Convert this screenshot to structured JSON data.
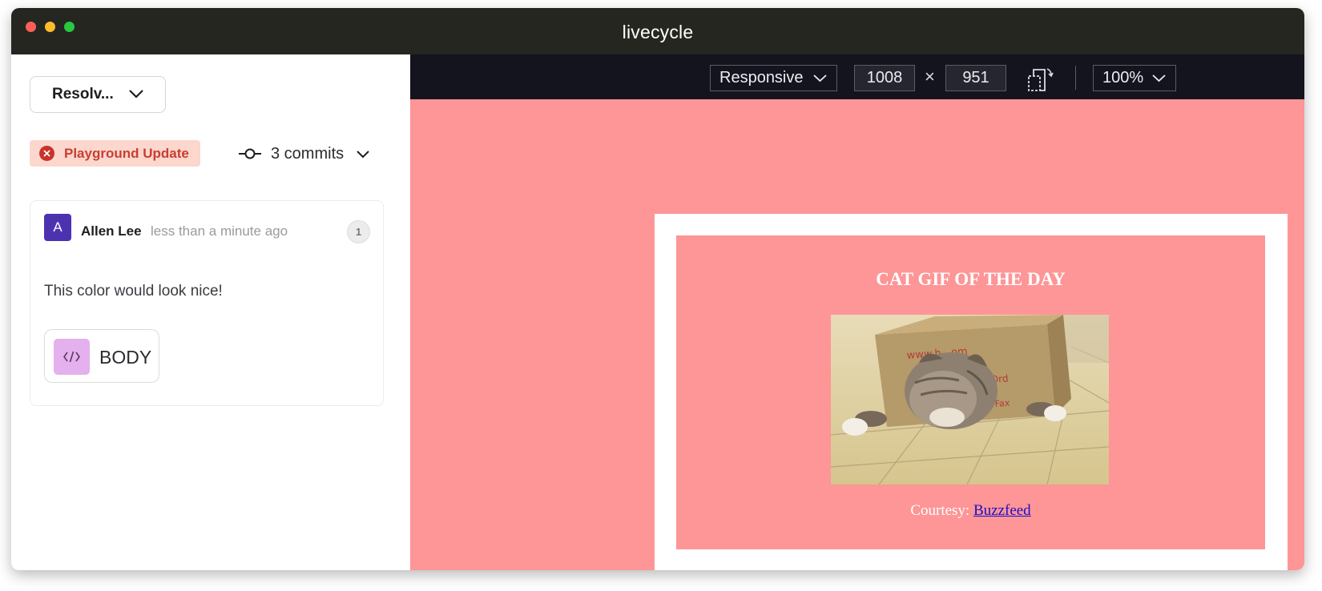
{
  "window": {
    "title": "livecycle"
  },
  "sidebar": {
    "status_dropdown": "Resolv...",
    "branch_badge": "Playground Update",
    "commits_label": "3 commits",
    "comment": {
      "avatar_initial": "A",
      "author": "Allen Lee",
      "timestamp": "less than a minute ago",
      "reply_count": "1",
      "text": "This color would look nice!",
      "element_tag": "BODY"
    }
  },
  "toolbar": {
    "device_mode": "Responsive",
    "width": "1008",
    "times_symbol": "×",
    "height": "951",
    "zoom": "100%"
  },
  "preview": {
    "heading": "CAT GIF OF THE DAY",
    "courtesy_prefix": "Courtesy: ",
    "courtesy_link": "Buzzfeed",
    "image_box_text": "www.h...om",
    "image_box_text2": "Ord",
    "image_box_text3": "Fax"
  },
  "colors": {
    "title_bar": "#262621",
    "preview_background": "#fe9596",
    "badge_background": "#fcd7cd",
    "badge_text": "#c93d32",
    "avatar": "#4d32b0",
    "code_chip": "#e4b0ee",
    "toolbar": "#14141f",
    "link": "#1a0dcc"
  },
  "icons": {
    "status_chevron": "chevron-down-icon",
    "branch_error": "x-circle-icon",
    "commit": "git-commit-icon",
    "element": "code-icon",
    "rotate": "rotate-device-icon"
  }
}
